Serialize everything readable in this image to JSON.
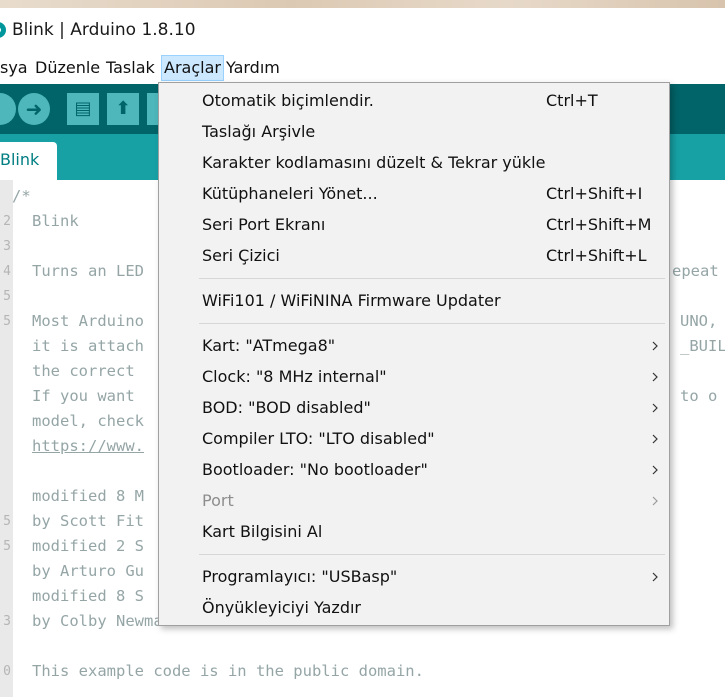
{
  "window": {
    "title": "Blink | Arduino 1.8.10"
  },
  "menubar": {
    "items": [
      {
        "label": "sya"
      },
      {
        "label": "Düzenle"
      },
      {
        "label": "Taslak"
      },
      {
        "label": "Araçlar"
      },
      {
        "label": "Yardım"
      }
    ]
  },
  "toolbar": {
    "buttons": [
      {
        "icon": "verify-icon"
      },
      {
        "icon": "upload-icon",
        "glyph": "➜"
      },
      {
        "icon": "new-icon",
        "glyph": "▤"
      },
      {
        "icon": "open-icon",
        "glyph": "⬆"
      },
      {
        "icon": "save-icon",
        "glyph": "⬇"
      }
    ]
  },
  "tabs": [
    {
      "label": "Blink"
    }
  ],
  "editor": {
    "lines": [
      {
        "num": "",
        "text": "/*"
      },
      {
        "num": "2",
        "text": "Blink"
      },
      {
        "num": "3",
        "text": ""
      },
      {
        "num": "4",
        "text": "Turns an LED"
      },
      {
        "num": "5",
        "text": ""
      },
      {
        "num": "5",
        "text": "Most Arduino"
      },
      {
        "num": "",
        "text": "it is attach"
      },
      {
        "num": "",
        "text": "the correct"
      },
      {
        "num": "",
        "text": "If you want"
      },
      {
        "num": "",
        "text": "model, check"
      },
      {
        "num": "",
        "text": "https://www."
      },
      {
        "num": "",
        "text": ""
      },
      {
        "num": "",
        "text": "modified 8 M"
      },
      {
        "num": "5",
        "text": "by Scott Fit"
      },
      {
        "num": "5",
        "text": "modified 2 S"
      },
      {
        "num": "",
        "text": "by Arturo Gu"
      },
      {
        "num": "",
        "text": "modified 8 S"
      },
      {
        "num": "3",
        "text": "by Colby Newman"
      },
      {
        "num": "",
        "text": ""
      },
      {
        "num": "0",
        "text": "This example code is in the public domain."
      }
    ],
    "right_fragments": [
      {
        "text": "epeat"
      },
      {
        "text": "UNO,"
      },
      {
        "text": "_BUIL"
      },
      {
        "text": "to o"
      }
    ]
  },
  "dropdown": {
    "items": [
      {
        "label": "Otomatik biçimlendir.",
        "shortcut": "Ctrl+T"
      },
      {
        "label": "Taslağı Arşivle",
        "shortcut": ""
      },
      {
        "label": "Karakter kodlamasını düzelt & Tekrar yükle",
        "shortcut": ""
      },
      {
        "label": "Kütüphaneleri Yönet...",
        "shortcut": "Ctrl+Shift+I"
      },
      {
        "label": "Seri Port Ekranı",
        "shortcut": "Ctrl+Shift+M"
      },
      {
        "label": "Seri Çizici",
        "shortcut": "Ctrl+Shift+L"
      },
      {
        "label": "WiFi101 / WiFiNINA Firmware Updater",
        "shortcut": ""
      },
      {
        "label": "Kart: \"ATmega8\"",
        "submenu": true
      },
      {
        "label": "Clock: \"8 MHz internal\"",
        "submenu": true
      },
      {
        "label": "BOD: \"BOD disabled\"",
        "submenu": true
      },
      {
        "label": "Compiler LTO: \"LTO disabled\"",
        "submenu": true
      },
      {
        "label": "Bootloader: \"No bootloader\"",
        "submenu": true
      },
      {
        "label": "Port",
        "submenu": true,
        "disabled": true
      },
      {
        "label": "Kart Bilgisini Al"
      },
      {
        "label": "Programlayıcı: \"USBasp\"",
        "submenu": true
      },
      {
        "label": "Önyükleyiciyi Yazdır"
      }
    ]
  },
  "colors": {
    "toolbar": "#006468",
    "tabstrip": "#17a1a5",
    "menu_bg": "#f2f2f2",
    "menu_active": "#cce8ff",
    "comment": "#95a5a6"
  }
}
